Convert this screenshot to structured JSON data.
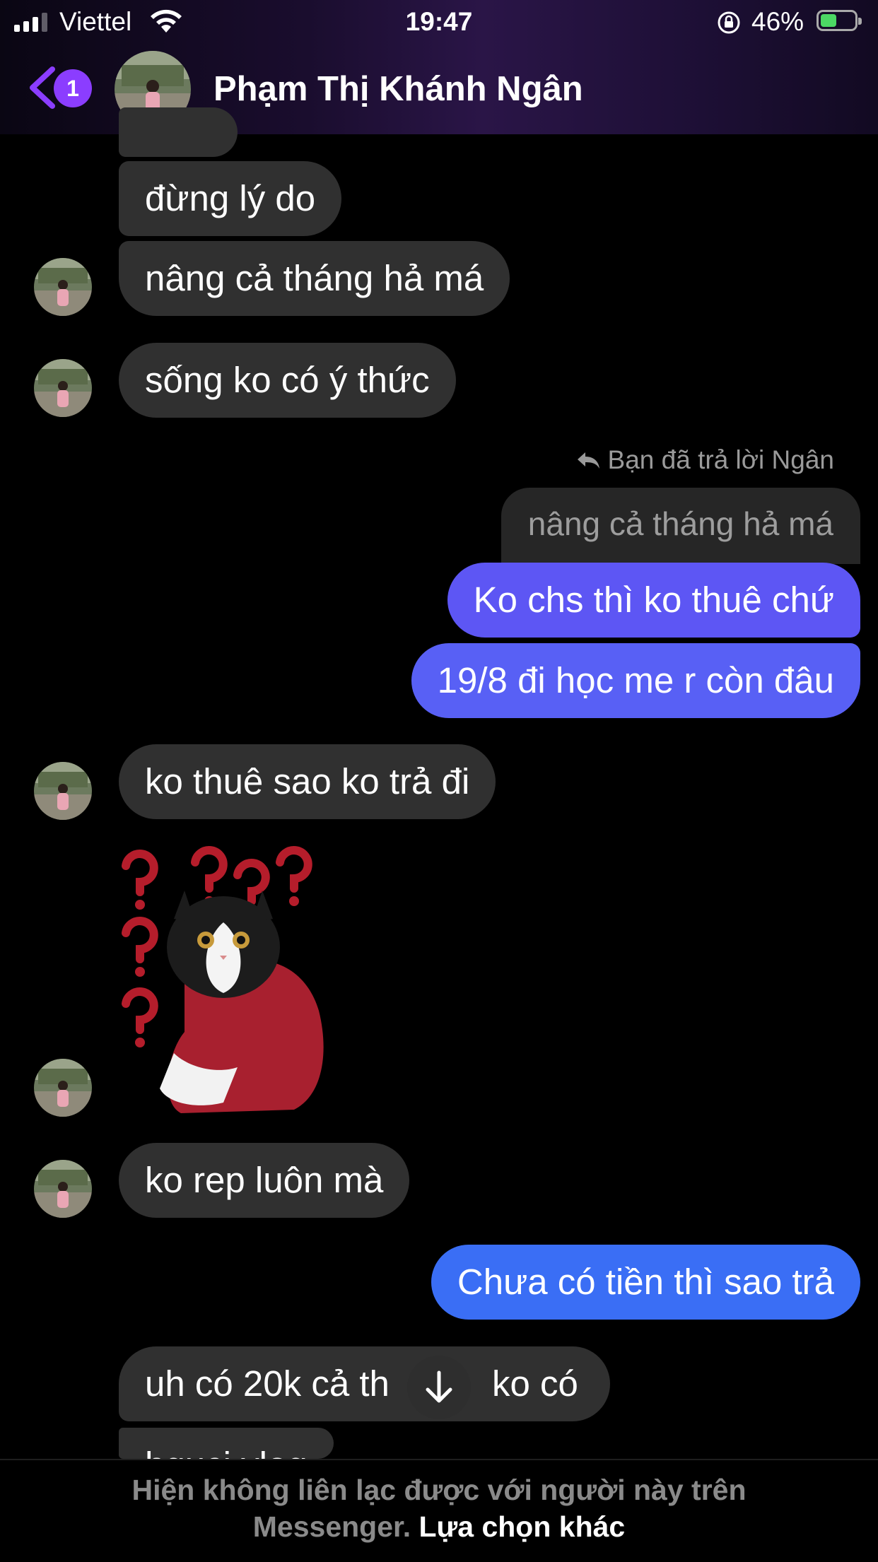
{
  "status_bar": {
    "carrier": "Viettel",
    "time": "19:47",
    "battery": "46%"
  },
  "header": {
    "unread_count": "1",
    "contact_name": "Phạm Thị Khánh Ngân"
  },
  "messages": {
    "m1": "đừng lý do",
    "m2": "nâng cả tháng hả má",
    "m3": "sống ko có ý thức",
    "reply_label": "Bạn đã trả lời Ngân",
    "reply_quote": "nâng cả tháng hả má",
    "m4": "Ko chs thì ko thuê chứ",
    "m5": "19/8 đi học me r còn đâu",
    "m6": "ko thuê sao ko trả đi",
    "m7": "ko rep luôn mà",
    "m8": "Chưa có tiền thì sao trả",
    "m9": "uh có 20k cả th",
    "m9b": "ko có",
    "m10": "hguci vlog"
  },
  "footer": {
    "line1": "Hiện không liên lạc được với người này trên",
    "line2_prefix": "Messenger.",
    "link": "Lựa chọn khác"
  },
  "colors": {
    "accent": "#8b3dff",
    "out_bubble_purple": "#5b55f5",
    "out_bubble_blue": "#3a6ef5",
    "in_bubble": "#303030"
  }
}
